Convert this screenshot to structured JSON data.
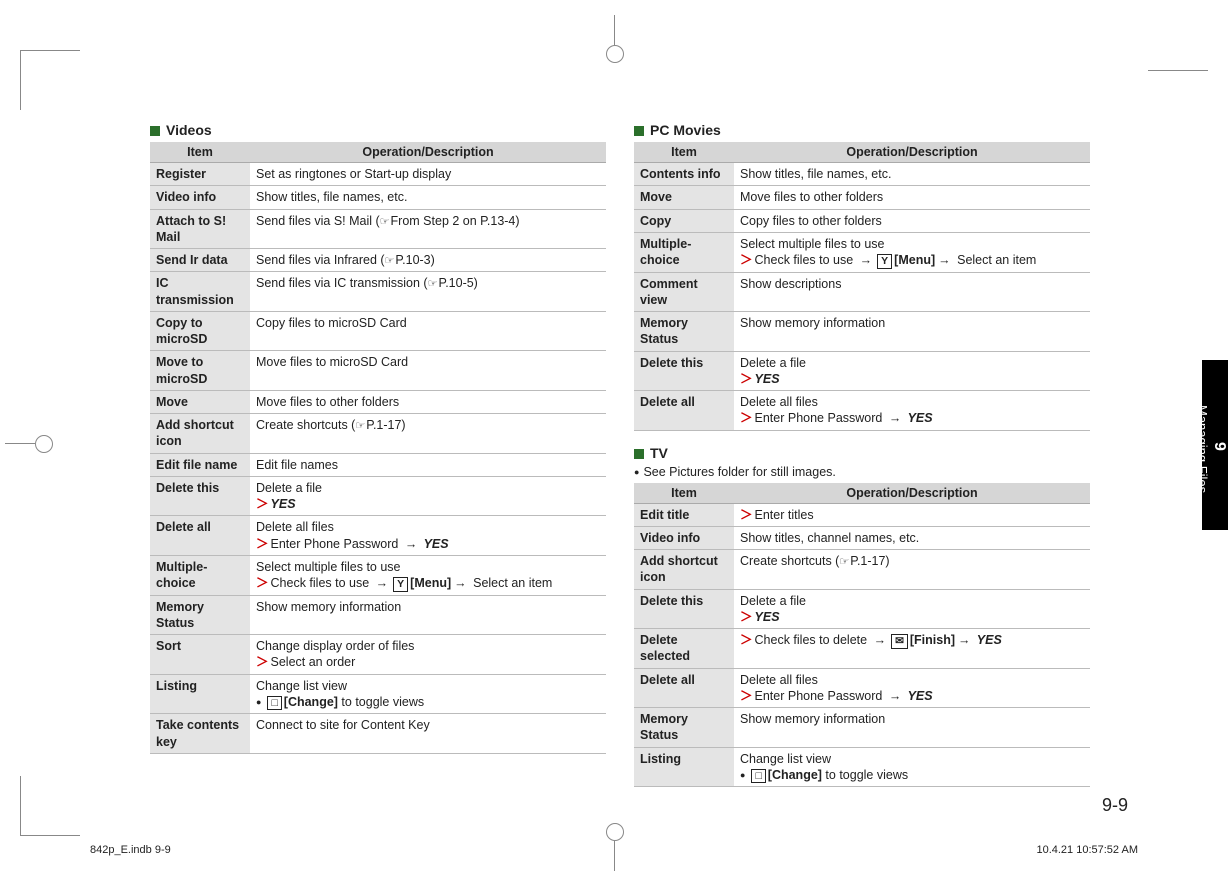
{
  "side": {
    "chapter_num": "9",
    "chapter_title": "Managing Files"
  },
  "page_number": "9-9",
  "footer": {
    "left": "842p_E.indb   9-9",
    "right": "10.4.21   10:57:52 AM"
  },
  "headers": {
    "item": "Item",
    "desc": "Operation/Description"
  },
  "videos": {
    "title": "Videos",
    "rows": [
      {
        "item": "Register",
        "desc": [
          {
            "t": "Set as ringtones or Start-up display"
          }
        ]
      },
      {
        "item": "Video info",
        "desc": [
          {
            "t": "Show titles, file names, etc."
          }
        ]
      },
      {
        "item": "Attach to S! Mail",
        "desc": [
          {
            "t": "Send files via S! Mail ("
          },
          {
            "ref": "From Step 2 on P.13-4"
          },
          {
            "t": ")"
          }
        ]
      },
      {
        "item": "Send Ir data",
        "desc": [
          {
            "t": "Send files via Infrared ("
          },
          {
            "ref": "P.10-3"
          },
          {
            "t": ")"
          }
        ]
      },
      {
        "item": "IC transmission",
        "desc": [
          {
            "t": "Send files via IC transmission ("
          },
          {
            "ref": "P.10-5"
          },
          {
            "t": ")"
          }
        ]
      },
      {
        "item": "Copy to microSD",
        "desc": [
          {
            "t": "Copy files to microSD Card"
          }
        ]
      },
      {
        "item": "Move to microSD",
        "desc": [
          {
            "t": "Move files to microSD Card"
          }
        ]
      },
      {
        "item": "Move",
        "desc": [
          {
            "t": "Move files to other folders"
          }
        ]
      },
      {
        "item": "Add shortcut icon",
        "desc": [
          {
            "t": "Create shortcuts ("
          },
          {
            "ref": "P.1-17"
          },
          {
            "t": ")"
          }
        ]
      },
      {
        "item": "Edit file name",
        "desc": [
          {
            "t": "Edit file names"
          }
        ]
      },
      {
        "item": "Delete this",
        "desc": [
          {
            "t": "Delete a file"
          },
          {
            "br": true
          },
          {
            "arrow": true
          },
          {
            "bi": "YES"
          }
        ]
      },
      {
        "item": "Delete all",
        "desc": [
          {
            "t": "Delete all files"
          },
          {
            "br": true
          },
          {
            "arrow": true
          },
          {
            "t": "Enter Phone Password "
          },
          {
            "rarr": true
          },
          {
            "bi": " YES"
          }
        ]
      },
      {
        "item": "Multiple-choice",
        "desc": [
          {
            "t": "Select multiple files to use"
          },
          {
            "br": true
          },
          {
            "arrow": true
          },
          {
            "t": "Check files to use "
          },
          {
            "rarr": true
          },
          {
            "key": "Y"
          },
          {
            "b": "[Menu]"
          },
          {
            "rarr": true
          },
          {
            "t": " Select an item"
          }
        ]
      },
      {
        "item": "Memory Status",
        "desc": [
          {
            "t": "Show memory information"
          }
        ]
      },
      {
        "item": "Sort",
        "desc": [
          {
            "t": "Change display order of files"
          },
          {
            "br": true
          },
          {
            "arrow": true
          },
          {
            "t": "Select an order"
          }
        ]
      },
      {
        "item": "Listing",
        "desc": [
          {
            "t": "Change list view"
          },
          {
            "br": true
          },
          {
            "bullet": true
          },
          {
            "key": "□"
          },
          {
            "b": "[Change]"
          },
          {
            "t": " to toggle views"
          }
        ]
      },
      {
        "item": "Take contents key",
        "desc": [
          {
            "t": "Connect to site for Content Key"
          }
        ]
      }
    ]
  },
  "pcmovies": {
    "title": "PC Movies",
    "rows": [
      {
        "item": "Contents info",
        "desc": [
          {
            "t": "Show titles, file names, etc."
          }
        ]
      },
      {
        "item": "Move",
        "desc": [
          {
            "t": "Move files to other folders"
          }
        ]
      },
      {
        "item": "Copy",
        "desc": [
          {
            "t": "Copy files to other folders"
          }
        ]
      },
      {
        "item": "Multiple-choice",
        "desc": [
          {
            "t": "Select multiple files to use"
          },
          {
            "br": true
          },
          {
            "arrow": true
          },
          {
            "t": "Check files to use "
          },
          {
            "rarr": true
          },
          {
            "key": "Y"
          },
          {
            "b": "[Menu]"
          },
          {
            "rarr": true
          },
          {
            "t": " Select an item"
          }
        ]
      },
      {
        "item": "Comment view",
        "desc": [
          {
            "t": "Show descriptions"
          }
        ]
      },
      {
        "item": "Memory Status",
        "desc": [
          {
            "t": "Show memory information"
          }
        ]
      },
      {
        "item": "Delete this",
        "desc": [
          {
            "t": "Delete a file"
          },
          {
            "br": true
          },
          {
            "arrow": true
          },
          {
            "bi": "YES"
          }
        ]
      },
      {
        "item": "Delete all",
        "desc": [
          {
            "t": "Delete all files"
          },
          {
            "br": true
          },
          {
            "arrow": true
          },
          {
            "t": "Enter Phone Password "
          },
          {
            "rarr": true
          },
          {
            "bi": " YES"
          }
        ]
      }
    ]
  },
  "tv": {
    "title": "TV",
    "note": "See Pictures folder for still images.",
    "rows": [
      {
        "item": "Edit title",
        "desc": [
          {
            "arrow": true
          },
          {
            "t": "Enter titles"
          }
        ]
      },
      {
        "item": "Video info",
        "desc": [
          {
            "t": "Show titles, channel names, etc."
          }
        ]
      },
      {
        "item": "Add shortcut icon",
        "desc": [
          {
            "t": "Create shortcuts ("
          },
          {
            "ref": "P.1-17"
          },
          {
            "t": ")"
          }
        ]
      },
      {
        "item": "Delete this",
        "desc": [
          {
            "t": "Delete a file"
          },
          {
            "br": true
          },
          {
            "arrow": true
          },
          {
            "bi": "YES"
          }
        ]
      },
      {
        "item": "Delete selected",
        "desc": [
          {
            "arrow": true
          },
          {
            "t": "Check files to delete "
          },
          {
            "rarr": true
          },
          {
            "key": "✉"
          },
          {
            "b": "[Finish]"
          },
          {
            "rarr": true
          },
          {
            "bi": " YES"
          }
        ]
      },
      {
        "item": "Delete all",
        "desc": [
          {
            "t": "Delete all files"
          },
          {
            "br": true
          },
          {
            "arrow": true
          },
          {
            "t": "Enter Phone Password "
          },
          {
            "rarr": true
          },
          {
            "bi": " YES"
          }
        ]
      },
      {
        "item": "Memory Status",
        "desc": [
          {
            "t": "Show memory information"
          }
        ]
      },
      {
        "item": "Listing",
        "desc": [
          {
            "t": "Change list view"
          },
          {
            "br": true
          },
          {
            "bullet": true
          },
          {
            "key": "□"
          },
          {
            "b": "[Change]"
          },
          {
            "t": " to toggle views"
          }
        ]
      }
    ]
  }
}
